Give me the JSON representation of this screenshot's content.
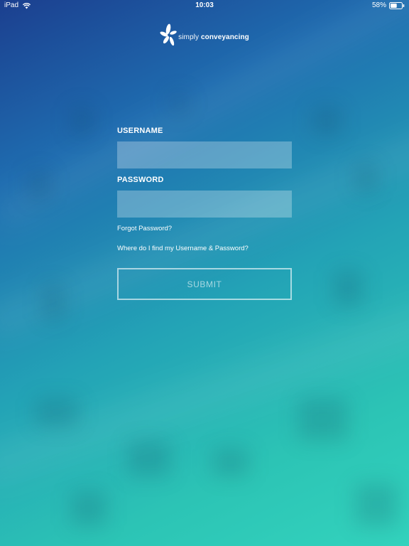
{
  "status_bar": {
    "device": "iPad",
    "time": "10:03",
    "battery": "58%",
    "battery_level": 0.58
  },
  "logo": {
    "prefix": "simply",
    "name": "conveyancing"
  },
  "form": {
    "username_label": "USERNAME",
    "username_value": "",
    "password_label": "PASSWORD",
    "password_value": "",
    "forgot_link": "Forgot Password?",
    "find_link": "Where do I find my Username & Password?",
    "submit_label": "SUBMIT"
  },
  "colors": {
    "gradient_top": "#1b3f8f",
    "gradient_bottom": "#33d3bd",
    "text": "#ffffff"
  },
  "icons": {
    "wifi": "wifi-icon",
    "battery": "battery-icon",
    "logo": "flower-logo-icon"
  }
}
